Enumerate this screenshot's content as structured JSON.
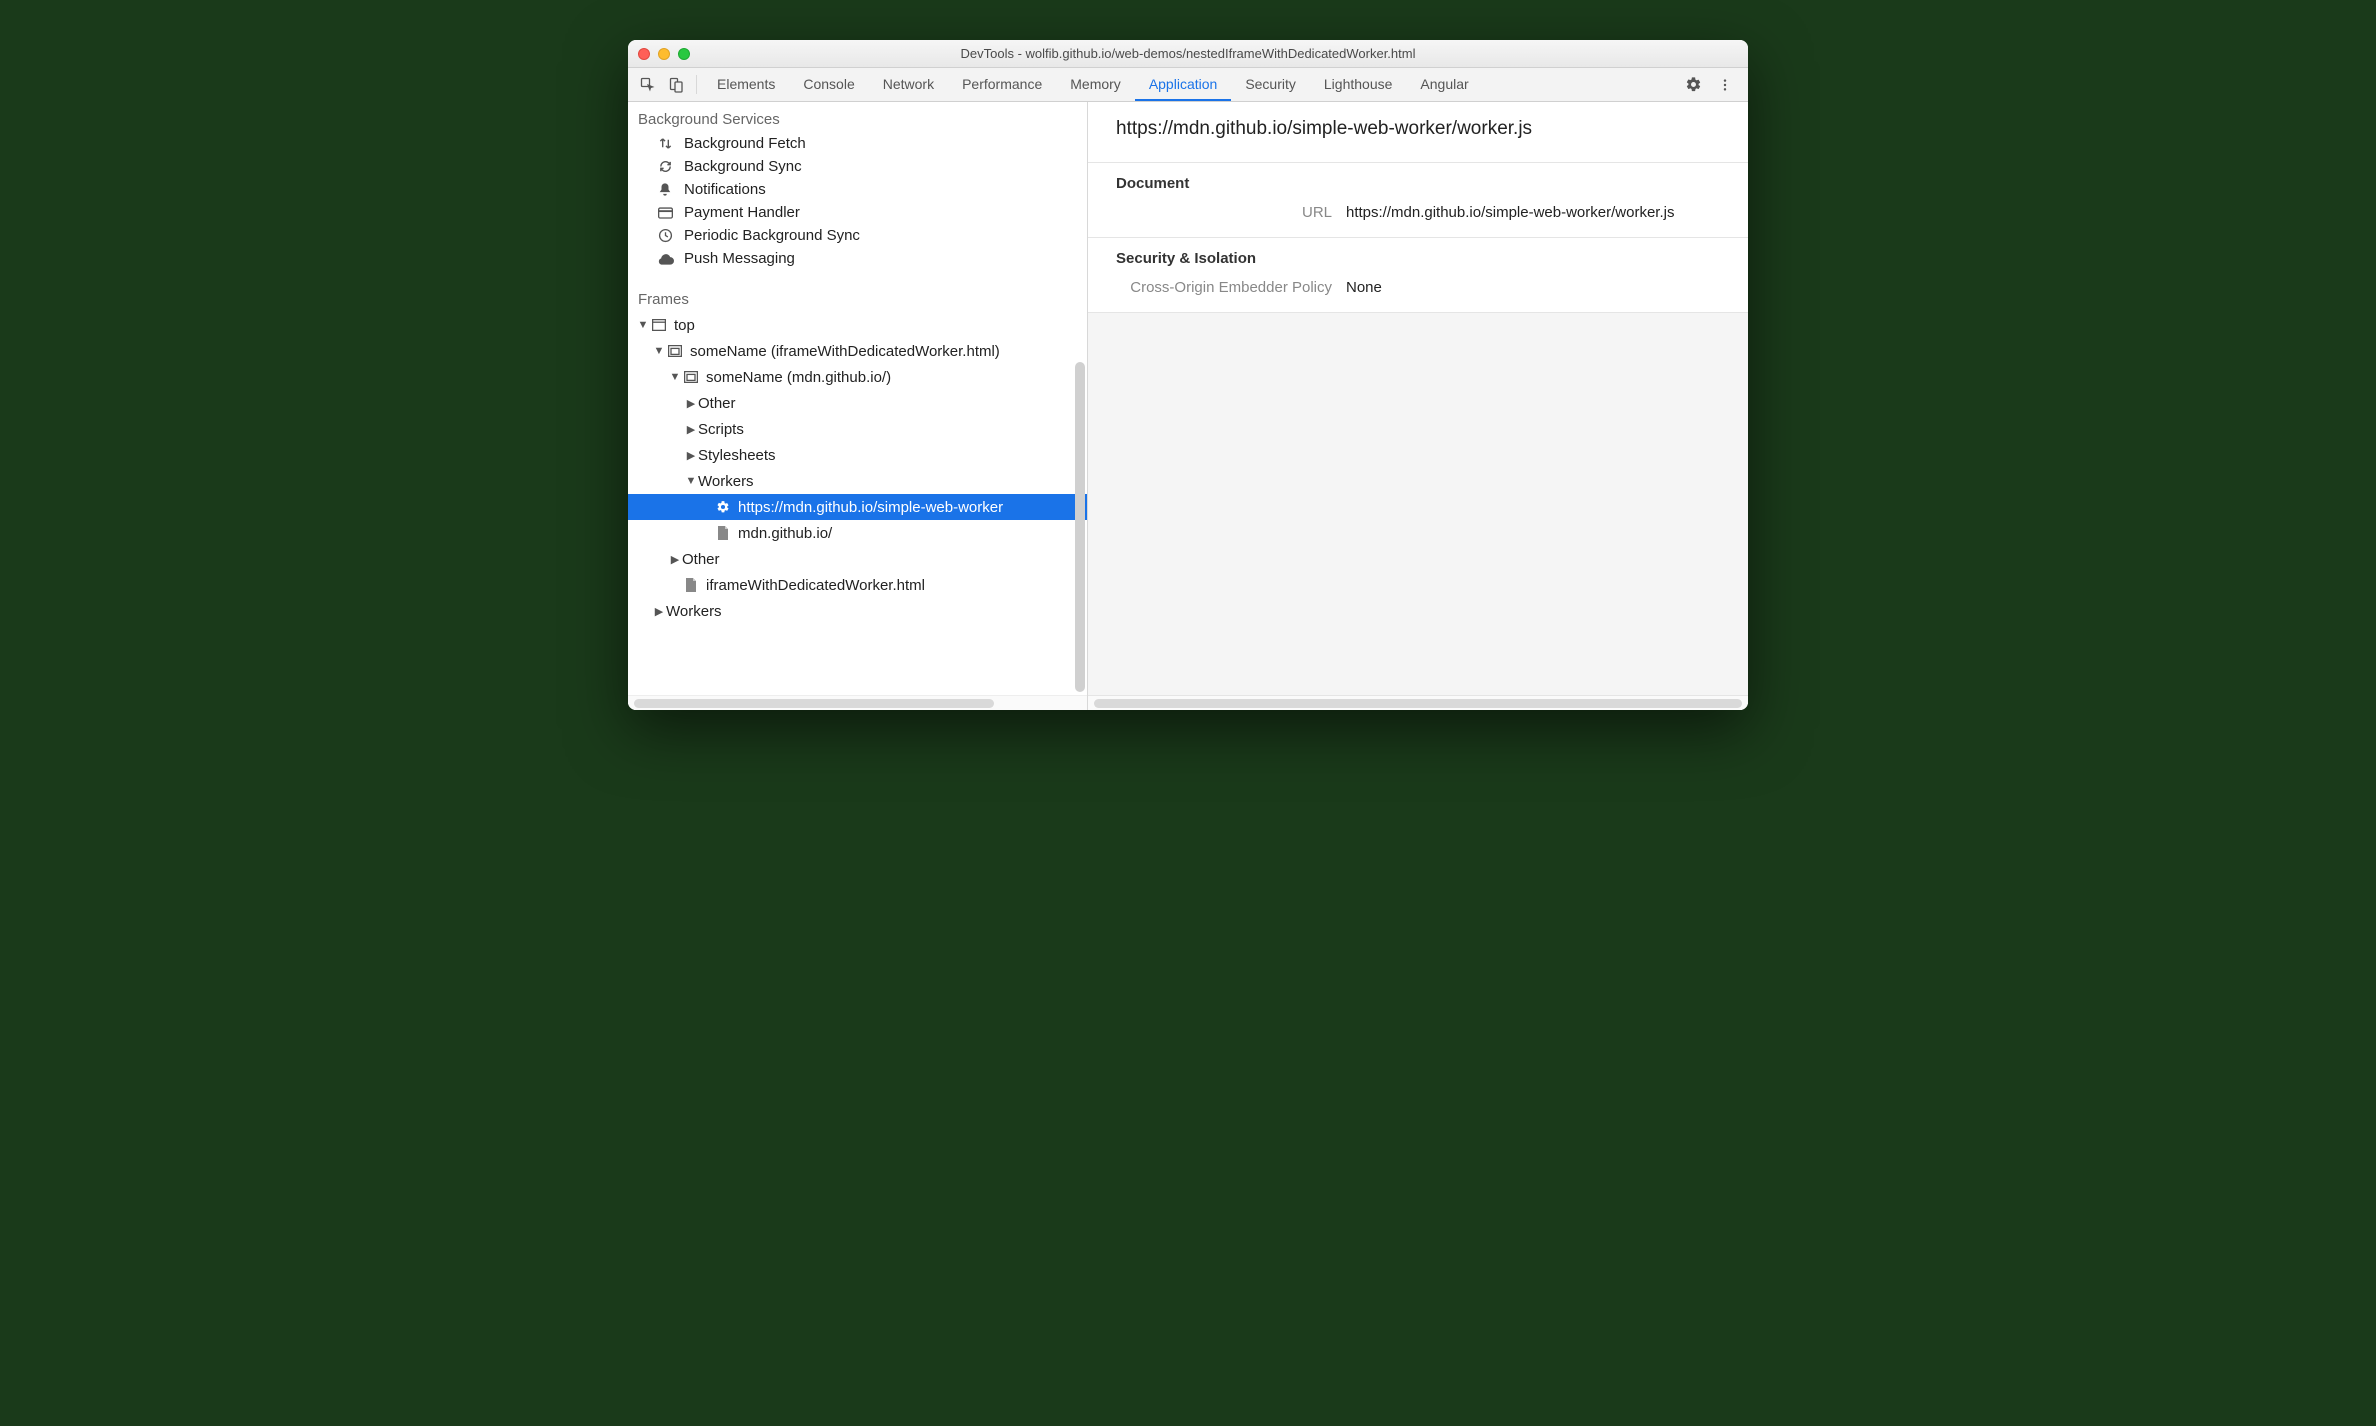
{
  "window": {
    "title": "DevTools - wolfib.github.io/web-demos/nestedIframeWithDedicatedWorker.html"
  },
  "tabs": {
    "items": [
      "Elements",
      "Console",
      "Network",
      "Performance",
      "Memory",
      "Application",
      "Security",
      "Lighthouse",
      "Angular"
    ],
    "active": 5
  },
  "sidebar": {
    "bgServicesTitle": "Background Services",
    "bgItems": [
      {
        "icon": "arrows-updown",
        "label": "Background Fetch"
      },
      {
        "icon": "sync",
        "label": "Background Sync"
      },
      {
        "icon": "bell",
        "label": "Notifications"
      },
      {
        "icon": "card",
        "label": "Payment Handler"
      },
      {
        "icon": "clock",
        "label": "Periodic Background Sync"
      },
      {
        "icon": "cloud",
        "label": "Push Messaging"
      }
    ],
    "framesTitle": "Frames",
    "tree": {
      "top": "top",
      "l1": "someName (iframeWithDedicatedWorker.html)",
      "l2": "someName (mdn.github.io/)",
      "l3a": "Other",
      "l3b": "Scripts",
      "l3c": "Stylesheets",
      "l3d": "Workers",
      "worker_sel": "https://mdn.github.io/simple-web-worker",
      "doc": "mdn.github.io/",
      "l2other": "Other",
      "iframeDoc": "iframeWithDedicatedWorker.html",
      "workers": "Workers"
    }
  },
  "detail": {
    "title": "https://mdn.github.io/simple-web-worker/worker.js",
    "groups": [
      {
        "h": "Document",
        "rows": [
          {
            "k": "URL",
            "v": "https://mdn.github.io/simple-web-worker/worker.js"
          }
        ]
      },
      {
        "h": "Security & Isolation",
        "rows": [
          {
            "k": "Cross-Origin Embedder Policy",
            "v": "None"
          }
        ]
      }
    ]
  }
}
